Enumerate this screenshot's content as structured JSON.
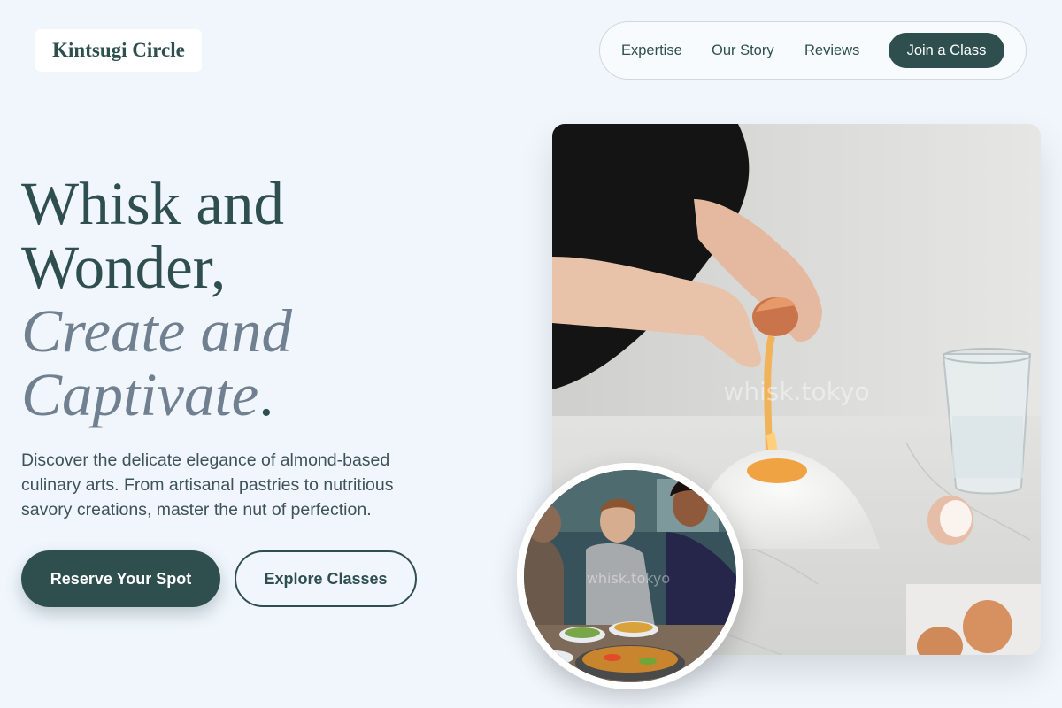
{
  "brand": {
    "name": "Kintsugi Circle"
  },
  "nav": {
    "links": [
      "Expertise",
      "Our Story",
      "Reviews"
    ],
    "cta": "Join a Class"
  },
  "hero": {
    "headline_line1": "Whisk and",
    "headline_line2": "Wonder,",
    "headline_italic1": "Create and",
    "headline_italic2": "Captivate",
    "headline_tail": ".",
    "subtitle": "Discover the delicate elegance of almond-based culinary arts. From artisanal pastries to nutritious savory creations, master the nut of perfection.",
    "primary_button": "Reserve Your Spot",
    "secondary_button": "Explore Classes"
  },
  "images": {
    "main_watermark": "whisk.tokyo",
    "circle_watermark": "whisk.tokyo"
  },
  "colors": {
    "background": "#f0f6fc",
    "primary": "#2f4f4f",
    "accent_italic": "#708090"
  }
}
